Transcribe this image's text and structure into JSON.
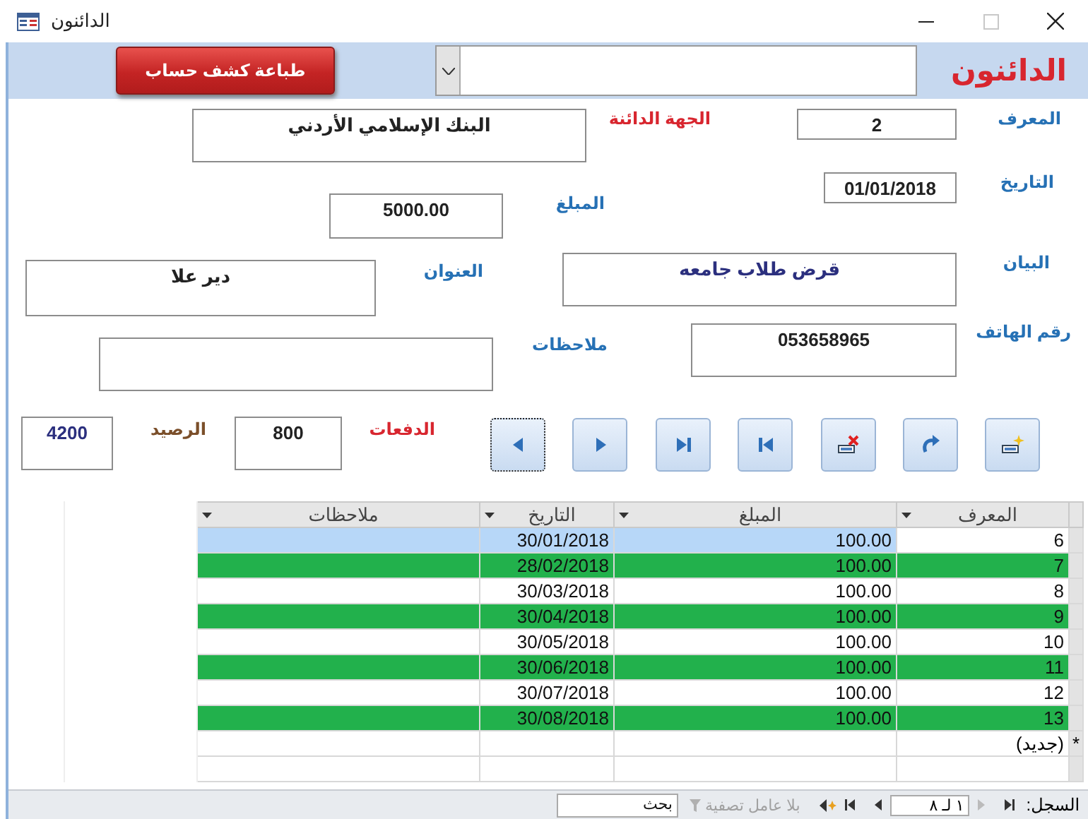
{
  "window": {
    "title": "الدائنون"
  },
  "header": {
    "title": "الدائنون",
    "print_button": "طباعة كشف حساب"
  },
  "fields": [
    {
      "label": "المعرف",
      "value": "2"
    },
    {
      "label": "الجهة الدائنة",
      "value": "البنك الإسلامي الأردني"
    },
    {
      "label": "التاريخ",
      "value": "01/01/2018"
    },
    {
      "label": "المبلغ",
      "value": "5000.00"
    },
    {
      "label": "البيان",
      "value": "قرض طلاب جامعه"
    },
    {
      "label": "العنوان",
      "value": "دير علا"
    },
    {
      "label": "رقم الهاتف",
      "value": "053658965"
    },
    {
      "label": "ملاحظات"
    },
    {
      "label": "الدفعات",
      "value": "800"
    },
    {
      "label": "الرصيد",
      "value": "4200"
    }
  ],
  "nav_buttons": [
    {
      "kind": "previous",
      "focused": true
    },
    {
      "kind": "next",
      "focused": false
    },
    {
      "kind": "last",
      "focused": false
    },
    {
      "kind": "first",
      "focused": false
    },
    {
      "kind": "delete",
      "focused": false
    },
    {
      "kind": "undo",
      "focused": false
    },
    {
      "kind": "new",
      "focused": false
    }
  ],
  "table": {
    "columns": [
      "المعرف",
      "المبلغ",
      "التاريخ",
      "ملاحظات"
    ],
    "rows": [
      {
        "id": "6",
        "amount": "100.00",
        "date": "30/01/2018",
        "color": "#ffffff",
        "selected": true
      },
      {
        "id": "7",
        "amount": "100.00",
        "date": "28/02/2018",
        "color": "#22b14c",
        "selected": false
      },
      {
        "id": "8",
        "amount": "100.00",
        "date": "30/03/2018",
        "color": "#ffffff",
        "selected": false
      },
      {
        "id": "9",
        "amount": "100.00",
        "date": "30/04/2018",
        "color": "#22b14c",
        "selected": false
      },
      {
        "id": "10",
        "amount": "100.00",
        "date": "30/05/2018",
        "color": "#ffffff",
        "selected": false
      },
      {
        "id": "11",
        "amount": "100.00",
        "date": "30/06/2018",
        "color": "#22b14c",
        "selected": false
      },
      {
        "id": "12",
        "amount": "100.00",
        "date": "30/07/2018",
        "color": "#ffffff",
        "selected": false
      },
      {
        "id": "13",
        "amount": "100.00",
        "date": "30/08/2018",
        "color": "#22b14c",
        "selected": false
      }
    ],
    "new_row": {
      "marker": "*",
      "label": "(جديد)"
    }
  },
  "record_nav": {
    "label": "السجل:",
    "position": "١ لـ ٨",
    "filter": "بلا عامل تصفية",
    "search_placeholder": "بحث"
  }
}
